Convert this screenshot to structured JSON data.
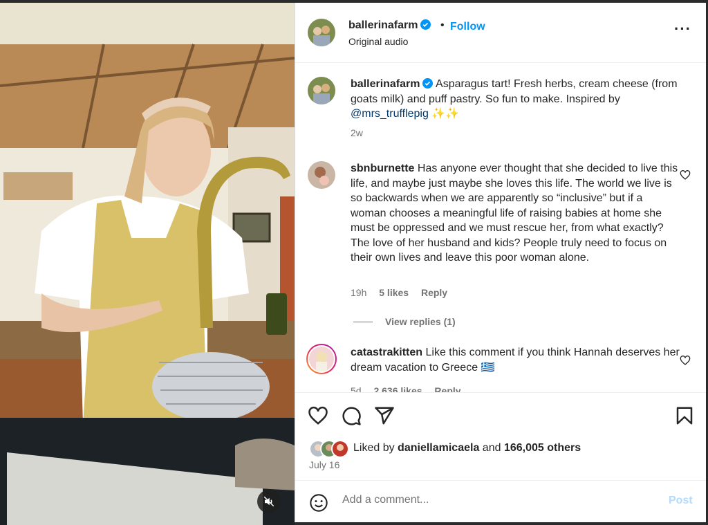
{
  "post": {
    "username": "ballerinafarm",
    "follow_label": "Follow",
    "separator": "•",
    "audio": "Original audio",
    "more": "···"
  },
  "caption": {
    "username": "ballerinafarm",
    "text": "Asparagus tart! Fresh herbs, cream cheese (from goats milk) and puff pastry. So fun to make. Inspired by ",
    "mention": "@mrs_trufflepig",
    "sparkles": "✨✨",
    "time": "2w"
  },
  "comments": [
    {
      "username": "sbnburnette",
      "text": "Has anyone ever thought that she decided to live this life, and maybe just maybe she loves this life. The world we live is so backwards when we are apparently so “inclusive” but if a woman chooses a meaningful life of raising babies at home she must be oppressed and we must rescue her, from what exactly? The love of her husband and kids? People truly need to focus on their own lives and leave this poor woman alone.",
      "time": "19h",
      "likes": "5 likes",
      "reply": "Reply",
      "view_replies": "View replies (1)"
    },
    {
      "username": "catastrakitten",
      "text": "Like this comment if you think Hannah deserves her dream vacation to Greece 🇬🇷",
      "time": "5d",
      "likes": "2,636 likes",
      "reply": "Reply"
    }
  ],
  "likes": {
    "prefix": "Liked by ",
    "user": "daniellamicaela",
    "middle": " and ",
    "others": "166,005 others"
  },
  "date": "July 16",
  "add_comment": {
    "placeholder": "Add a comment...",
    "post_label": "Post"
  },
  "colors": {
    "accent": "#0095f6",
    "mention": "#00376b",
    "muted": "#737373",
    "post_disabled": "#b3dbff"
  },
  "icons": {
    "verified": "verified-badge-icon",
    "heart": "heart-icon",
    "comment": "comment-icon",
    "share": "share-icon",
    "save": "bookmark-icon",
    "emoji": "emoji-icon",
    "mute": "muted-speaker-icon"
  }
}
